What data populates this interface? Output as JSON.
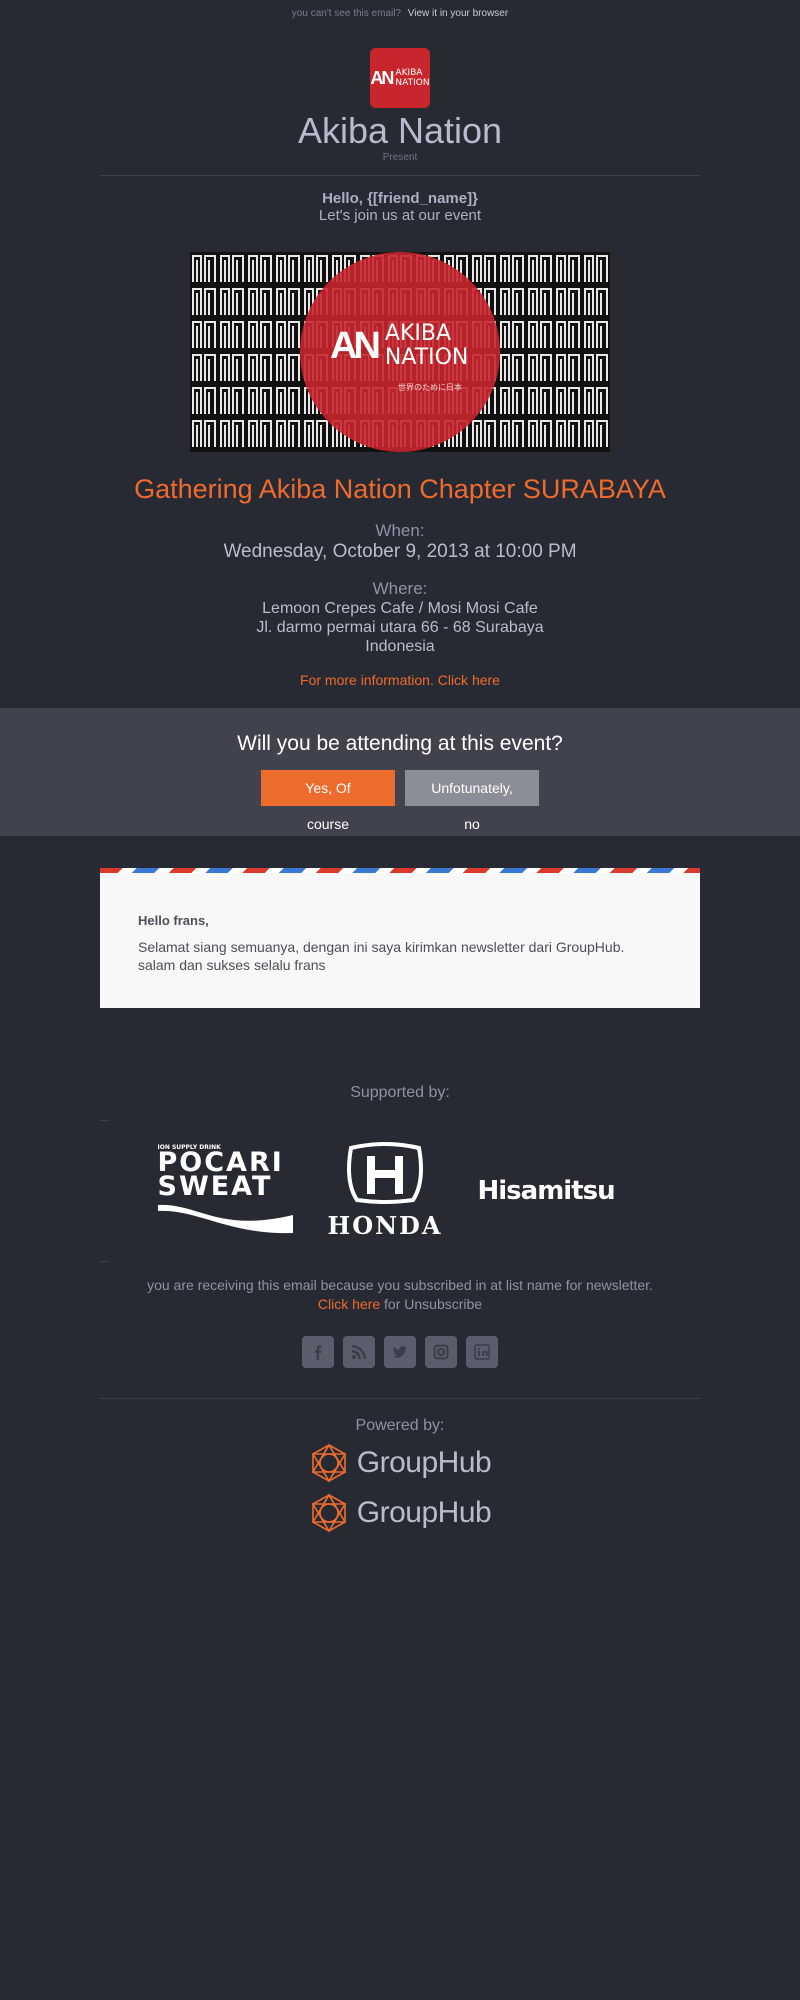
{
  "header": {
    "cant_see": "you can't see this email?",
    "view_link": "View it in your browser",
    "logo_mark": "AN",
    "logo_text_line1": "AKIBA",
    "logo_text_line2": "NATION",
    "brand": "Akiba Nation",
    "present": "Present"
  },
  "greeting": {
    "hello": "Hello, {[friend_name]}",
    "invite": "Let's join us at our event"
  },
  "banner": {
    "mark": "AN",
    "line1": "AKIBA",
    "line2": "NATION",
    "tagline": "世界のために日本"
  },
  "event": {
    "title": "Gathering Akiba Nation Chapter SURABAYA",
    "when_label": "When:",
    "when_value": "Wednesday, October 9, 2013 at 10:00 PM",
    "where_label": "Where:",
    "where_line1": "Lemoon Crepes Cafe / Mosi Mosi Cafe",
    "where_line2": "Jl. darmo permai utara 66 - 68 Surabaya",
    "where_line3": "Indonesia",
    "more_info": "For more information. Click here"
  },
  "rsvp": {
    "question": "Will you be attending at this event?",
    "yes_label": "Yes, Of course",
    "no_label": "Unfotunately, no"
  },
  "letter": {
    "salutation": "Hello frans,",
    "message": "Selamat siang semuanya, dengan ini saya kirimkan newsletter dari GroupHub. salam dan sukses selalu frans"
  },
  "sponsors": {
    "label": "Supported by:",
    "pocari_small": "ION SUPPLY DRINK",
    "pocari_line1": "POCARI",
    "pocari_line2": "SWEAT",
    "honda": "HONDA",
    "hisamitsu": "Hisamitsu"
  },
  "footer": {
    "notice": "you are receiving this email because you subscribed in at list name for newsletter.",
    "click_here": "Click here",
    "unsubscribe_suffix": " for Unsubscribe",
    "social_icons": [
      "facebook-icon",
      "rss-icon",
      "twitter-icon",
      "instagram-icon",
      "linkedin-icon"
    ],
    "powered_label": "Powered by:",
    "grouphub": "GroupHub"
  },
  "colors": {
    "background": "#282a33",
    "accent": "#ee6b2e",
    "brand_red": "#c8252c",
    "panel": "#40434d"
  }
}
